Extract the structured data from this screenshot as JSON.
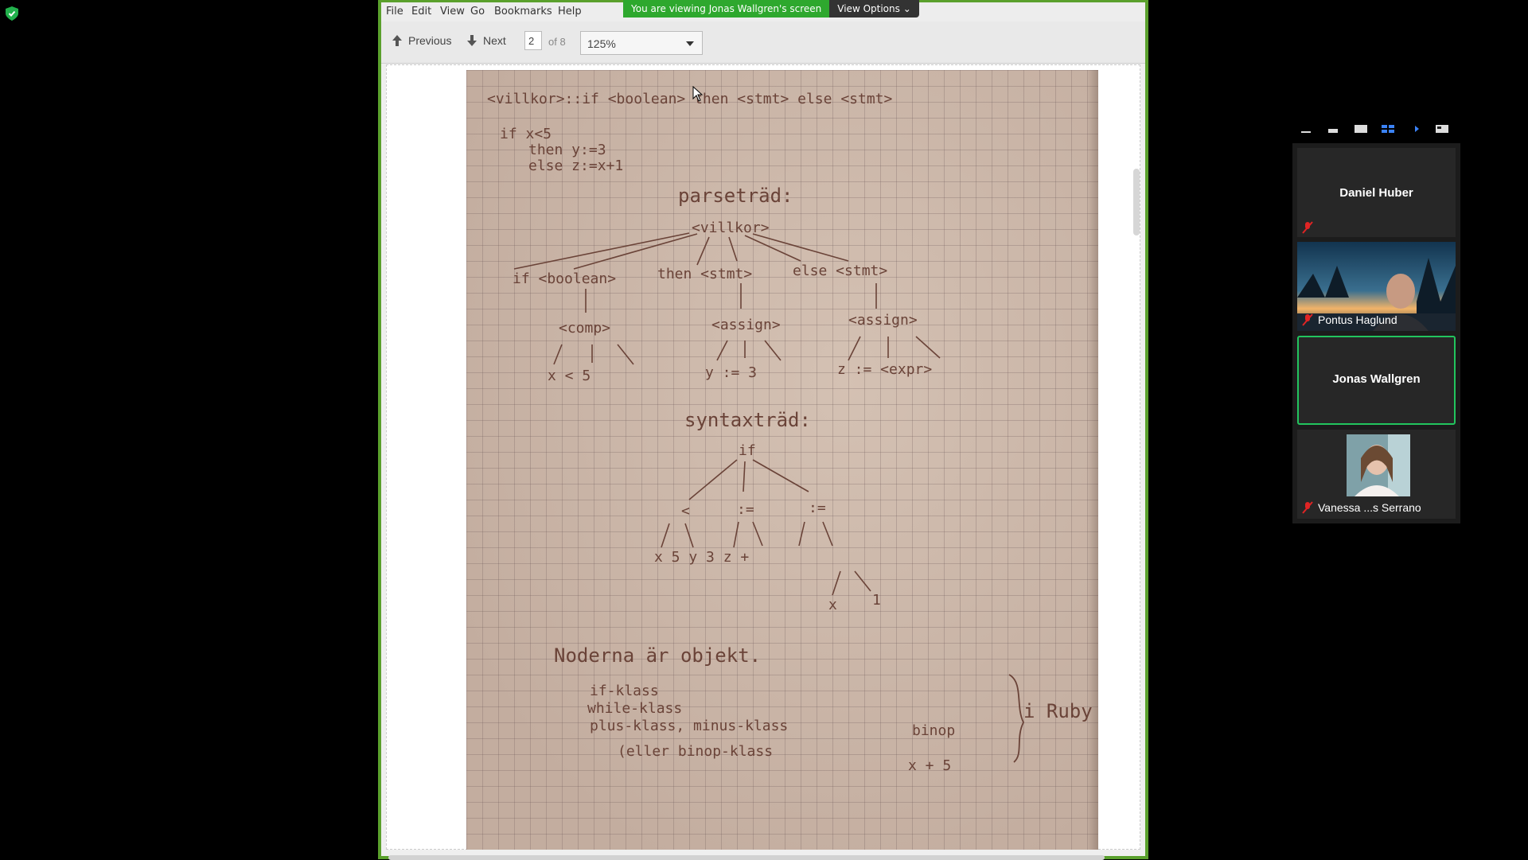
{
  "menu": [
    "File",
    "Edit",
    "View",
    "Go",
    "Bookmarks",
    "Help"
  ],
  "toolbar": {
    "previous_label": "Previous",
    "next_label": "Next",
    "page_current": "2",
    "page_total": "of 8",
    "zoom": "125%"
  },
  "banner": {
    "message": "You are viewing Jonas Wallgren's screen",
    "options_label": "View Options"
  },
  "document": {
    "line1": "<villkor>::if <boolean> then <stmt> else <stmt>",
    "code": [
      "if x<5",
      "then y:=3",
      "else z:=x+1"
    ],
    "parse_title": "parseträd:",
    "syntax_title": "syntaxträd:",
    "objects_title": "Noderna är objekt.",
    "classes": [
      "if-klass",
      "while-klass",
      "plus-klass, minus-klass",
      "(eller binop-klass"
    ],
    "ruby": "i Ruby"
  },
  "participants": [
    {
      "name": "Daniel Huber",
      "muted": true,
      "video": false,
      "active": false
    },
    {
      "name": "Pontus Haglund",
      "muted": true,
      "video": true,
      "active": false
    },
    {
      "name": "Jonas Wallgren",
      "muted": false,
      "video": false,
      "active": true
    },
    {
      "name": "Vanessa ...s Serrano",
      "muted": true,
      "video": true,
      "active": false
    }
  ],
  "colors": {
    "share_border": "#5aa02c",
    "banner_green": "#2ea82e",
    "active_speaker": "#22c55e",
    "mute_red": "#e02424"
  }
}
